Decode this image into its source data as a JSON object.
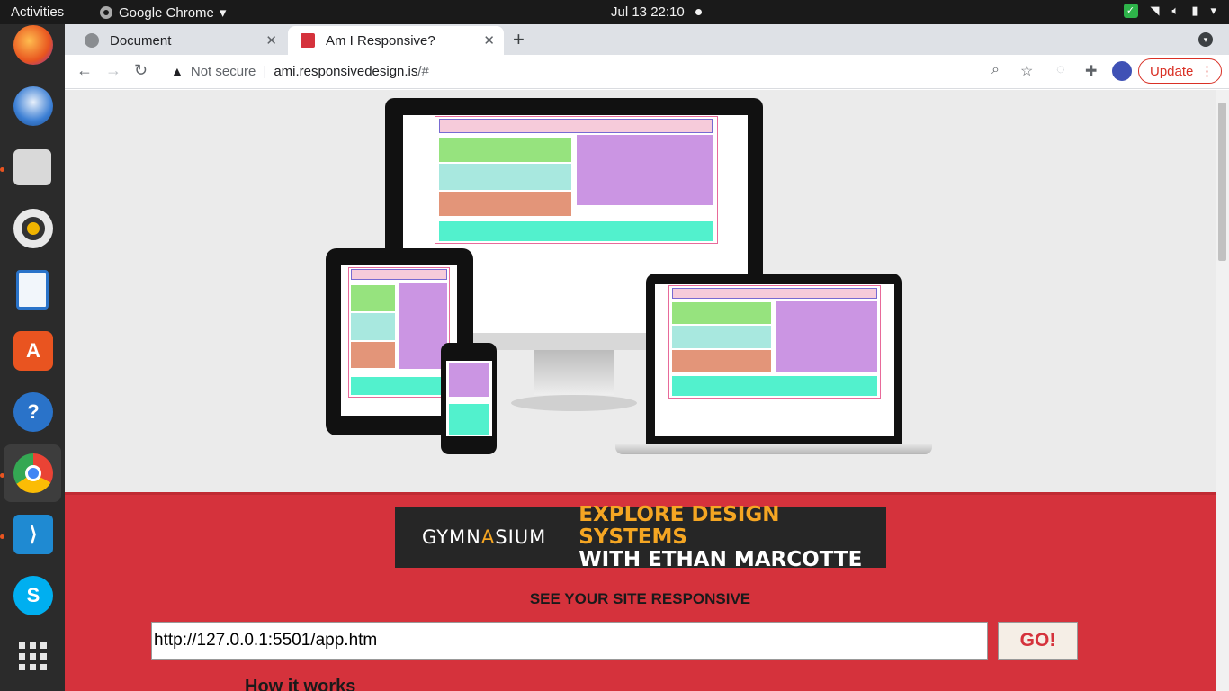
{
  "system_bar": {
    "activities": "Activities",
    "app_name": "Google Chrome",
    "clock": "Jul 13  22:10"
  },
  "dock": {
    "apps": [
      "Firefox",
      "Thunderbird",
      "Files",
      "Rhythmbox",
      "LibreOffice Writer",
      "Ubuntu Software",
      "Help",
      "Google Chrome",
      "Visual Studio Code",
      "Skype",
      "Show Applications"
    ]
  },
  "browser": {
    "tabs": [
      {
        "title": "Document",
        "active": false
      },
      {
        "title": "Am I Responsive?",
        "active": true
      }
    ],
    "omnibox": {
      "security_label": "Not secure",
      "url_host": "ami.responsivedesign.is",
      "url_path": "/#"
    },
    "update_label": "Update"
  },
  "page": {
    "ad": {
      "brand_pre": "GYMN",
      "brand_accent": "A",
      "brand_post": "SIUM",
      "line1": "EXPLORE DESIGN SYSTEMS",
      "line2": "WITH ETHAN MARCOTTE"
    },
    "heading": "SEE YOUR SITE RESPONSIVE",
    "url_input_value": "http://127.0.0.1:5501/app.htm",
    "go_label": "GO!",
    "how_it_works": "How it works"
  },
  "colors": {
    "accent_red": "#d5323c",
    "ad_orange": "#f5a623",
    "chrome_tabstrip": "#dee1e6"
  }
}
